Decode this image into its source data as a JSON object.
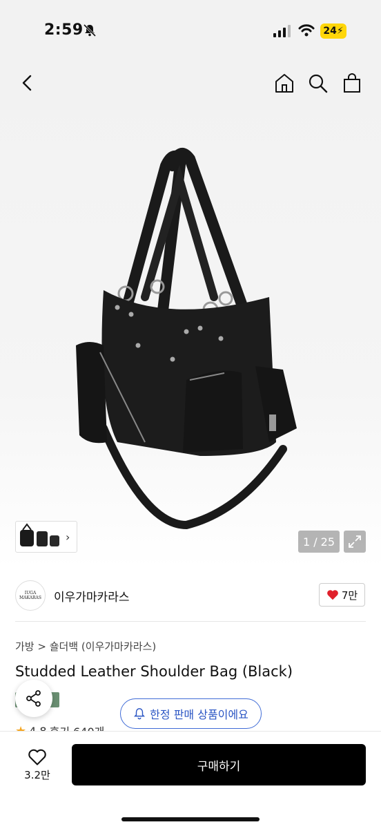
{
  "status_bar": {
    "time": "2:59",
    "battery": "24"
  },
  "nav": {
    "icons": [
      "back-icon",
      "home-icon",
      "search-icon",
      "cart-icon"
    ]
  },
  "gallery": {
    "counter": "1 / 25",
    "thumbnail_arrow": "›"
  },
  "brand": {
    "logo_line1": "IUGA",
    "logo_line2": "MAKARAS",
    "name": "이우가마카라스",
    "likes": "7만"
  },
  "product": {
    "breadcrumb_category": "가방",
    "breadcrumb_separator": ">",
    "breadcrumb_sub": "숄더백 (이우가마카라스)",
    "title": "Studded Leather Shoulder Bag (Black)",
    "rating": "4.8",
    "reviews": "후기 640개"
  },
  "limited_notice": "한정 판매 상품이에요",
  "bottom_bar": {
    "wish_count": "3.2만",
    "buy_label": "구매하기"
  },
  "colors": {
    "accent_blue": "#3f6bd6",
    "heart_red": "#e0202b",
    "star": "#f5a623"
  }
}
